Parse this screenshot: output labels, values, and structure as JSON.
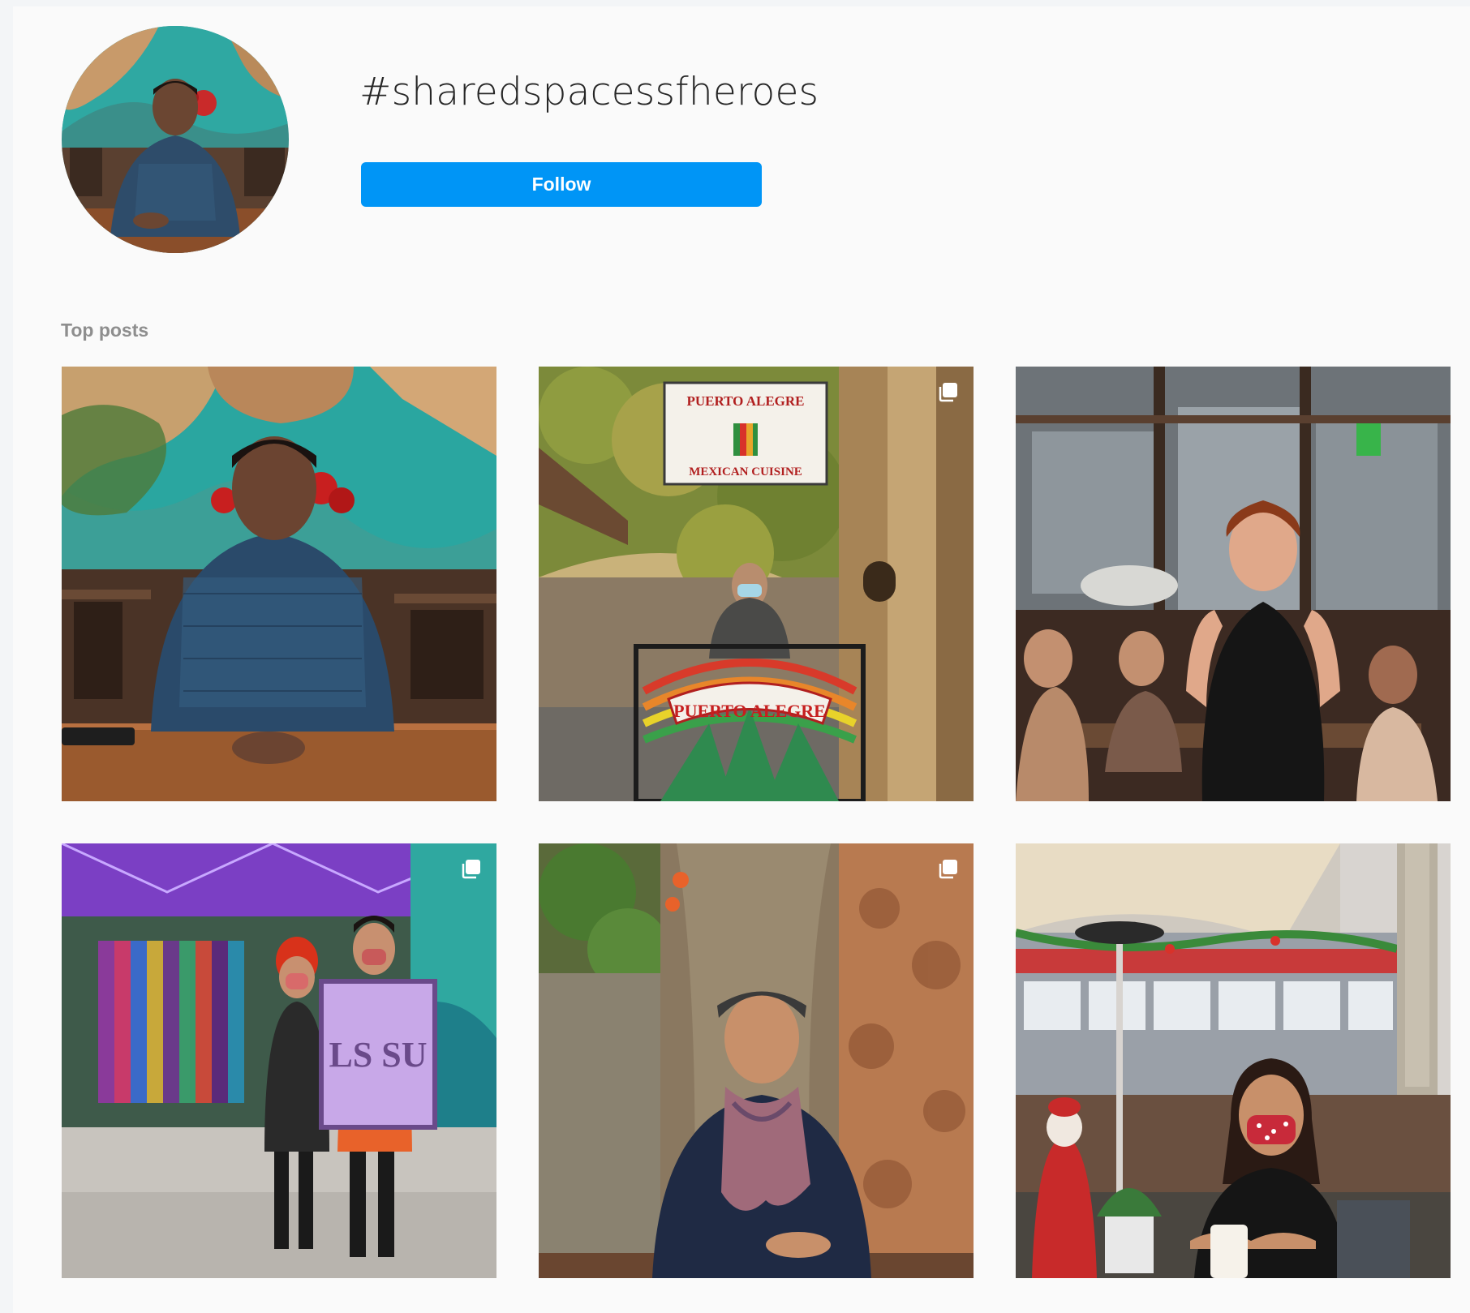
{
  "hashtag": {
    "title": "#sharedspacessfheroes",
    "follow_label": "Follow"
  },
  "section": {
    "top_posts_label": "Top posts"
  },
  "posts": [
    {
      "row": 1,
      "col": 1,
      "multi": false
    },
    {
      "row": 1,
      "col": 2,
      "multi": true
    },
    {
      "row": 1,
      "col": 3,
      "multi": false
    },
    {
      "row": 2,
      "col": 1,
      "multi": true
    },
    {
      "row": 2,
      "col": 2,
      "multi": true
    },
    {
      "row": 2,
      "col": 3,
      "multi": false
    }
  ],
  "signs": {
    "restaurant_sign_top": "PUERTO ALEGRE",
    "restaurant_sign_bottom": "MEXICAN CUISINE",
    "gate_sign": "PUERTO ALEGRE",
    "shop_sign": "LS SU"
  },
  "colors": {
    "follow_button": "#0095f6",
    "label_gray": "#8e8e8e",
    "title_text": "#262626",
    "canopy_purple": "#7b3fc4"
  }
}
